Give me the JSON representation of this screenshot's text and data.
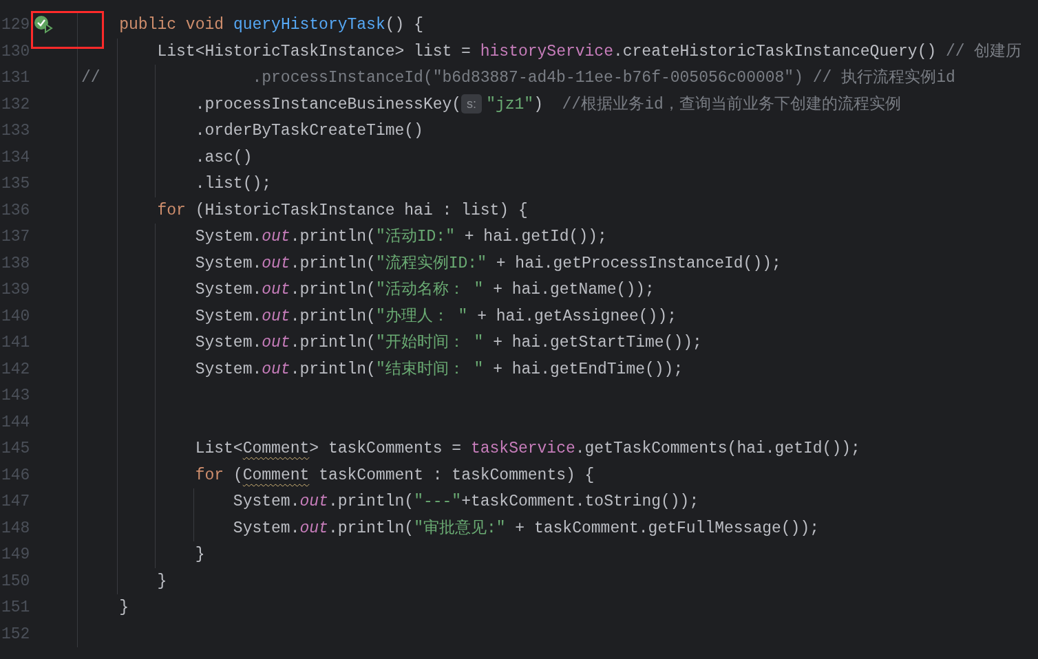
{
  "editor": {
    "lines": [
      {
        "number": "129",
        "run_icon": true,
        "framed": true,
        "tokens": [
          {
            "text": "    public",
            "kind": "keyword"
          },
          {
            "text": " void",
            "kind": "keyword"
          },
          {
            "text": " queryHistoryTask",
            "kind": "declaration"
          },
          {
            "text": "() {",
            "kind": "plain"
          }
        ]
      },
      {
        "number": "130",
        "tokens": [
          {
            "text": "        List<HistoricTaskInstance> list = ",
            "kind": "plain"
          },
          {
            "text": "historyService",
            "kind": "field"
          },
          {
            "text": ".createHistoricTaskInstanceQuery() ",
            "kind": "plain"
          },
          {
            "text": "// 创建历",
            "kind": "comment"
          }
        ]
      },
      {
        "number": "131",
        "tokens": [
          {
            "text": "//                .processInstanceId(\"b6d83887-ad4b-11ee-b76f-005056c00008\") // 执行流程实例id",
            "kind": "comment"
          }
        ]
      },
      {
        "number": "132",
        "tokens": [
          {
            "text": "            .processInstanceBusinessKey(",
            "kind": "plain"
          },
          {
            "text": "s:",
            "kind": "hint"
          },
          {
            "text": "\"jz1\"",
            "kind": "string"
          },
          {
            "text": ")  ",
            "kind": "plain"
          },
          {
            "text": "//根据业务id，查询当前业务下创建的流程实例",
            "kind": "comment"
          }
        ]
      },
      {
        "number": "133",
        "tokens": [
          {
            "text": "            .orderByTaskCreateTime()",
            "kind": "plain"
          }
        ]
      },
      {
        "number": "134",
        "tokens": [
          {
            "text": "            .asc()",
            "kind": "plain"
          }
        ]
      },
      {
        "number": "135",
        "tokens": [
          {
            "text": "            .list();",
            "kind": "plain"
          }
        ]
      },
      {
        "number": "136",
        "tokens": [
          {
            "text": "        for",
            "kind": "keyword"
          },
          {
            "text": " (HistoricTaskInstance hai : list) {",
            "kind": "plain"
          }
        ]
      },
      {
        "number": "137",
        "tokens": [
          {
            "text": "            System.",
            "kind": "plain"
          },
          {
            "text": "out",
            "kind": "static"
          },
          {
            "text": ".println(",
            "kind": "plain"
          },
          {
            "text": "\"活动ID:\"",
            "kind": "string"
          },
          {
            "text": " + hai.getId());",
            "kind": "plain"
          }
        ]
      },
      {
        "number": "138",
        "tokens": [
          {
            "text": "            System.",
            "kind": "plain"
          },
          {
            "text": "out",
            "kind": "static"
          },
          {
            "text": ".println(",
            "kind": "plain"
          },
          {
            "text": "\"流程实例ID:\"",
            "kind": "string"
          },
          {
            "text": " + hai.getProcessInstanceId());",
            "kind": "plain"
          }
        ]
      },
      {
        "number": "139",
        "tokens": [
          {
            "text": "            System.",
            "kind": "plain"
          },
          {
            "text": "out",
            "kind": "static"
          },
          {
            "text": ".println(",
            "kind": "plain"
          },
          {
            "text": "\"活动名称： \"",
            "kind": "string"
          },
          {
            "text": " + hai.getName());",
            "kind": "plain"
          }
        ]
      },
      {
        "number": "140",
        "tokens": [
          {
            "text": "            System.",
            "kind": "plain"
          },
          {
            "text": "out",
            "kind": "static"
          },
          {
            "text": ".println(",
            "kind": "plain"
          },
          {
            "text": "\"办理人： \"",
            "kind": "string"
          },
          {
            "text": " + hai.getAssignee());",
            "kind": "plain"
          }
        ]
      },
      {
        "number": "141",
        "tokens": [
          {
            "text": "            System.",
            "kind": "plain"
          },
          {
            "text": "out",
            "kind": "static"
          },
          {
            "text": ".println(",
            "kind": "plain"
          },
          {
            "text": "\"开始时间： \"",
            "kind": "string"
          },
          {
            "text": " + hai.getStartTime());",
            "kind": "plain"
          }
        ]
      },
      {
        "number": "142",
        "tokens": [
          {
            "text": "            System.",
            "kind": "plain"
          },
          {
            "text": "out",
            "kind": "static"
          },
          {
            "text": ".println(",
            "kind": "plain"
          },
          {
            "text": "\"结束时间： \"",
            "kind": "string"
          },
          {
            "text": " + hai.getEndTime());",
            "kind": "plain"
          }
        ]
      },
      {
        "number": "143"
      },
      {
        "number": "144"
      },
      {
        "number": "145",
        "tokens": [
          {
            "text": "            List<",
            "kind": "plain"
          },
          {
            "text": "Comment",
            "kind": "warning"
          },
          {
            "text": "> taskComments = ",
            "kind": "plain"
          },
          {
            "text": "taskService",
            "kind": "field"
          },
          {
            "text": ".getTaskComments(hai.getId());",
            "kind": "plain"
          }
        ]
      },
      {
        "number": "146",
        "tokens": [
          {
            "text": "            for",
            "kind": "keyword"
          },
          {
            "text": " (",
            "kind": "plain"
          },
          {
            "text": "Comment",
            "kind": "warning"
          },
          {
            "text": " taskComment : taskComments) {",
            "kind": "plain"
          }
        ]
      },
      {
        "number": "147",
        "tokens": [
          {
            "text": "                System.",
            "kind": "plain"
          },
          {
            "text": "out",
            "kind": "static"
          },
          {
            "text": ".println(",
            "kind": "plain"
          },
          {
            "text": "\"---\"",
            "kind": "string"
          },
          {
            "text": "+taskComment.toString());",
            "kind": "plain"
          }
        ]
      },
      {
        "number": "148",
        "tokens": [
          {
            "text": "                System.",
            "kind": "plain"
          },
          {
            "text": "out",
            "kind": "static"
          },
          {
            "text": ".println(",
            "kind": "plain"
          },
          {
            "text": "\"审批意见:\"",
            "kind": "string"
          },
          {
            "text": " + taskComment.getFullMessage());",
            "kind": "plain"
          }
        ]
      },
      {
        "number": "149",
        "tokens": [
          {
            "text": "            }",
            "kind": "plain"
          }
        ]
      },
      {
        "number": "150",
        "tokens": [
          {
            "text": "        }",
            "kind": "plain"
          }
        ]
      },
      {
        "number": "151",
        "tokens": [
          {
            "text": "    }",
            "kind": "plain"
          }
        ]
      },
      {
        "number": "152"
      }
    ]
  }
}
